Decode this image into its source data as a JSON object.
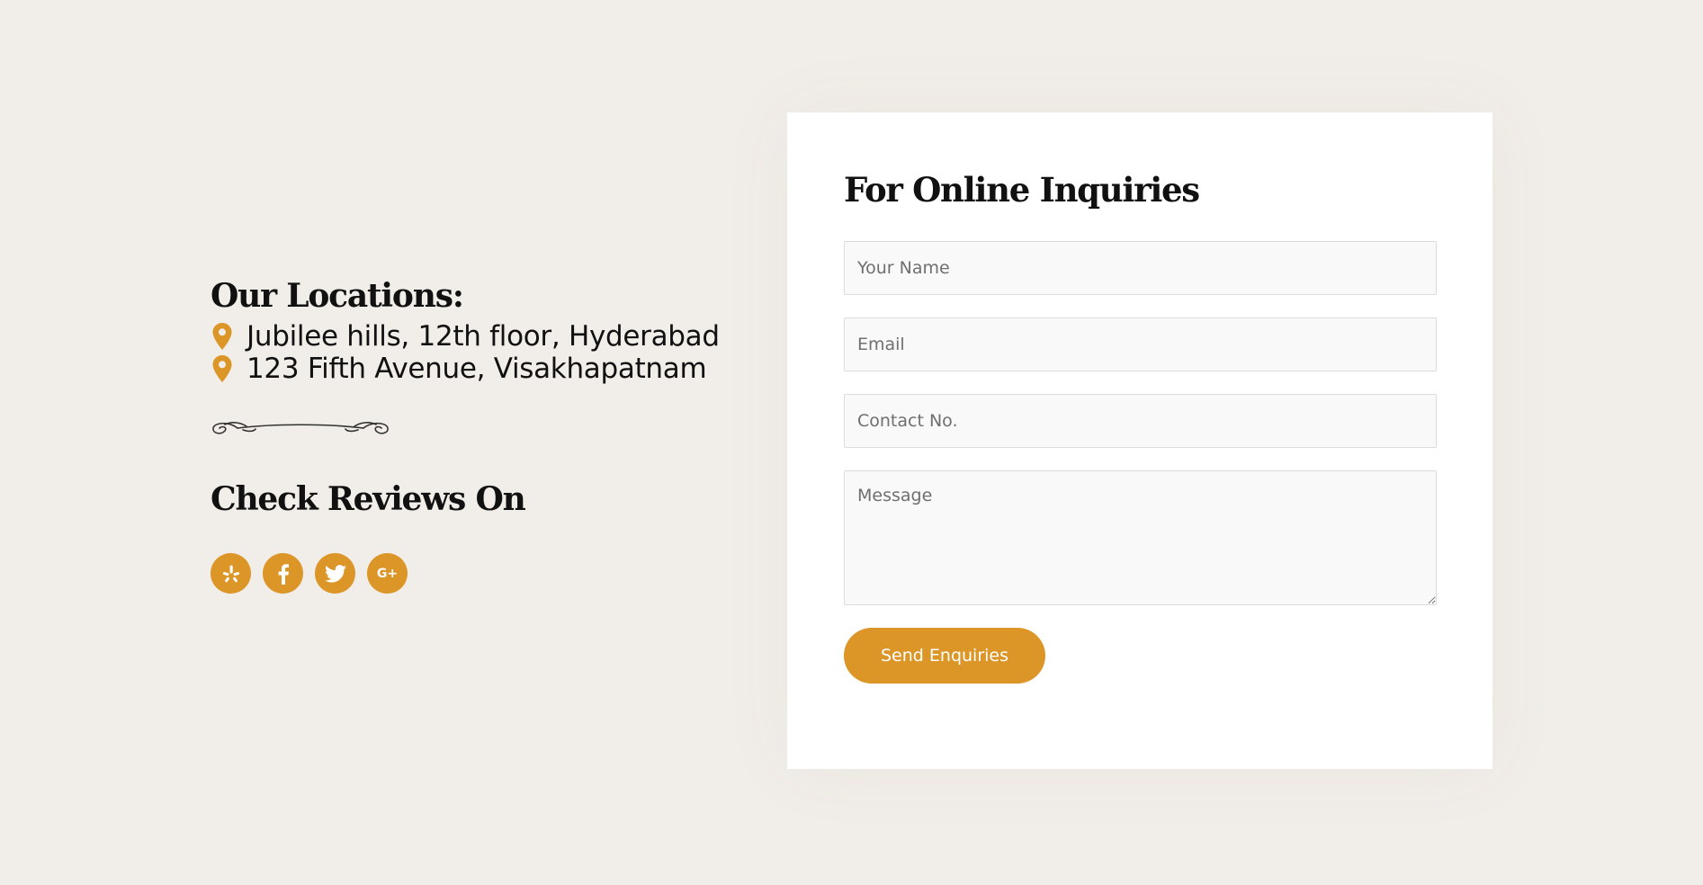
{
  "colors": {
    "background": "#f1ede8",
    "accent": "#dc9527",
    "card": "#ffffff",
    "heading_text": "#111111"
  },
  "locations": {
    "title": "Our Locations:",
    "icon": "map-pin-icon",
    "items": [
      {
        "label": "Jubilee hills, 12th floor, Hyderabad"
      },
      {
        "label": "123 Fifth Avenue, Visakhapatnam"
      }
    ]
  },
  "divider": {
    "icon": "ornamental-flourish-divider"
  },
  "reviews": {
    "title": "Check Reviews On",
    "links": [
      {
        "name": "yelp",
        "icon": "yelp-icon"
      },
      {
        "name": "facebook",
        "icon": "facebook-icon"
      },
      {
        "name": "twitter",
        "icon": "twitter-icon"
      },
      {
        "name": "google-plus",
        "icon": "google-plus-icon",
        "glyph": "G+"
      }
    ]
  },
  "form": {
    "title": "For Online Inquiries",
    "name_placeholder": "Your Name",
    "email_placeholder": "Email",
    "contact_placeholder": "Contact No.",
    "message_placeholder": "Message",
    "submit_label": "Send Enquiries"
  }
}
